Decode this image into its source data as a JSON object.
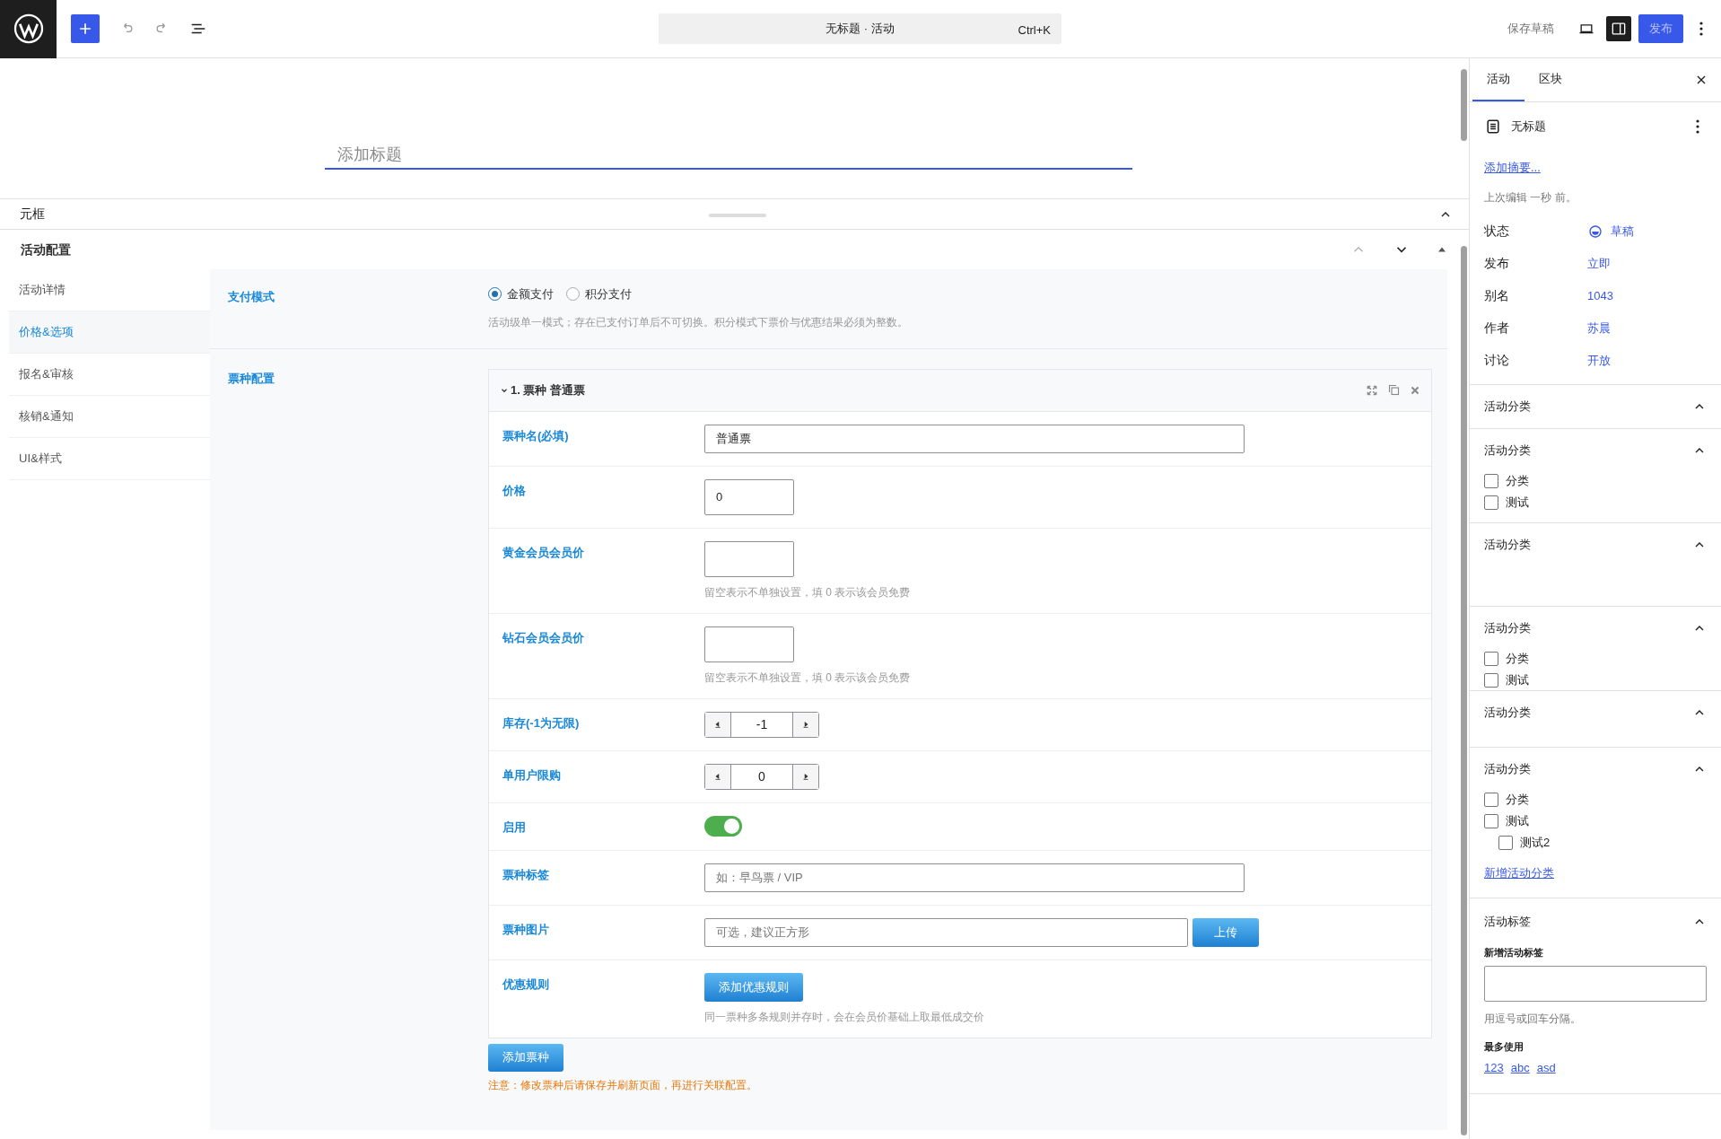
{
  "toolbar": {
    "title": "无标题 · 活动",
    "shortcut": "Ctrl+K",
    "save_draft": "保存草稿",
    "publish": "发布",
    "sidebar_toggle_on": true
  },
  "editor": {
    "title_placeholder": "添加标题"
  },
  "metabox": {
    "title": "元框",
    "expanded": true,
    "section_title": "活动配置",
    "nav": [
      {
        "label": "活动详情",
        "selected": false
      },
      {
        "label": "价格&选项",
        "selected": true
      },
      {
        "label": "报名&审核",
        "selected": false
      },
      {
        "label": "核销&通知",
        "selected": false
      },
      {
        "label": "UI&样式",
        "selected": false
      }
    ],
    "payment": {
      "label": "支付模式",
      "options": [
        {
          "label": "金额支付",
          "selected": true
        },
        {
          "label": "积分支付",
          "selected": false
        }
      ],
      "hint": "活动级单一模式；存在已支付订单后不可切换。积分模式下票价与优惠结果必须为整数。"
    },
    "tickets": {
      "label": "票种配置",
      "cards": [
        {
          "title": "1. 票种 普通票",
          "expanded": true,
          "fields": [
            {
              "kind": "text",
              "label": "票种名(必填)",
              "value": "普通票"
            },
            {
              "kind": "number",
              "label": "价格",
              "value": "0"
            },
            {
              "kind": "number",
              "label": "黄金会员会员价",
              "hint": "留空表示不单独设置，填 0 表示该会员免费"
            },
            {
              "kind": "number",
              "label": "钻石会员会员价",
              "hint": "留空表示不单独设置，填 0 表示该会员免费"
            },
            {
              "kind": "stepper",
              "label": "库存(-1为无限)",
              "value": "-1"
            },
            {
              "kind": "stepper",
              "label": "单用户限购",
              "value": "0"
            },
            {
              "kind": "toggle",
              "label": "启用",
              "on": true
            },
            {
              "kind": "text",
              "label": "票种标签",
              "placeholder": "如：早鸟票 / VIP"
            },
            {
              "kind": "upload",
              "label": "票种图片",
              "placeholder": "可选，建议正方形",
              "button": "上传"
            },
            {
              "kind": "button",
              "label": "优惠规则",
              "button": "添加优惠规则",
              "hint": "同一票种多条规则并存时，会在会员价基础上取最低成交价"
            }
          ]
        }
      ],
      "add_button": "添加票种",
      "note": "注意：修改票种后请保存并刷新页面，再进行关联配置。"
    }
  },
  "sidebar": {
    "tabs": [
      {
        "label": "活动",
        "selected": true
      },
      {
        "label": "区块",
        "selected": false
      }
    ],
    "post_title": "无标题",
    "excerpt_link": "添加摘要...",
    "last_edited": "上次编辑 一秒 前。",
    "meta": [
      {
        "label": "状态",
        "value": "草稿",
        "kind": "status"
      },
      {
        "label": "发布",
        "value": "立即"
      },
      {
        "label": "别名",
        "value": "1043"
      },
      {
        "label": "作者",
        "value": "苏晨"
      },
      {
        "label": "讨论",
        "value": "开放"
      }
    ],
    "panels": [
      {
        "title": "活动分类",
        "expanded": true
      },
      {
        "title": "活动分类",
        "expanded": true,
        "items": [
          {
            "label": "分类",
            "checked": false
          },
          {
            "label": "测试",
            "checked": false
          }
        ]
      },
      {
        "title": "活动分类",
        "expanded": true
      },
      {
        "title": "活动分类",
        "expanded": true,
        "items": [
          {
            "label": "分类",
            "checked": false
          },
          {
            "label": "测试",
            "checked": false
          }
        ]
      },
      {
        "title": "活动分类",
        "expanded": true
      },
      {
        "title": "活动分类",
        "expanded": true,
        "items": [
          {
            "label": "分类",
            "checked": false
          },
          {
            "label": "测试",
            "checked": false,
            "children": [
              {
                "label": "测试2",
                "checked": false
              }
            ]
          }
        ],
        "link": "新增活动分类"
      }
    ],
    "tags": {
      "title": "活动标签",
      "expanded": true,
      "field_label": "新增活动标签",
      "hint": "用逗号或回车分隔。",
      "most_used_label": "最多使用",
      "most_used": [
        "123",
        "abc",
        "asd"
      ]
    }
  }
}
